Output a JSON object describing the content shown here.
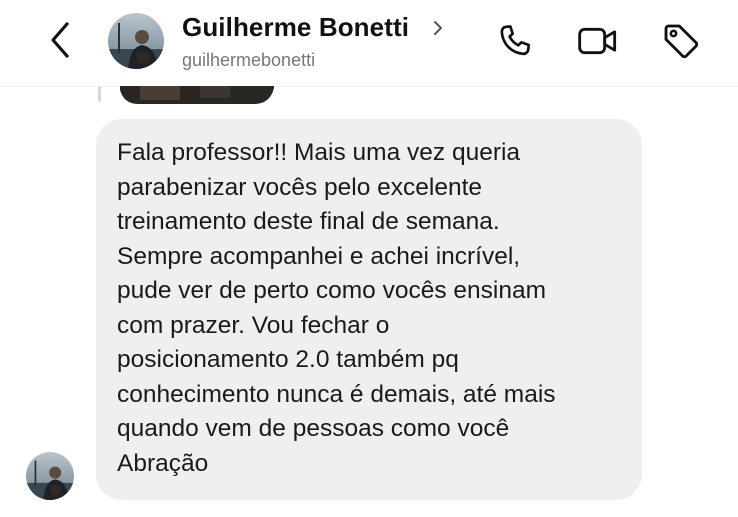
{
  "header": {
    "contact_name": "Guilherme Bonetti",
    "username": "guilhermebonetti",
    "icons": [
      "back-arrow-icon",
      "chevron-right-icon",
      "phone-icon",
      "video-camera-icon",
      "tag-icon"
    ]
  },
  "message": {
    "lines": [
      "Fala professor!! Mais uma vez queria",
      "parabenizar vocês pelo excelente",
      "treinamento deste final de semana.",
      "Sempre acompanhei e achei incrível,",
      "pude ver de perto como vocês ensinam",
      "com prazer. Vou fechar o",
      "posicionamento 2.0 também pq",
      "conhecimento nunca é demais, até mais",
      "quando vem de pessoas como você",
      "Abração"
    ]
  },
  "colors": {
    "bubble_background": "#efeff2",
    "text": "#111111",
    "username": "#777777",
    "icon_stroke": "#111111"
  }
}
